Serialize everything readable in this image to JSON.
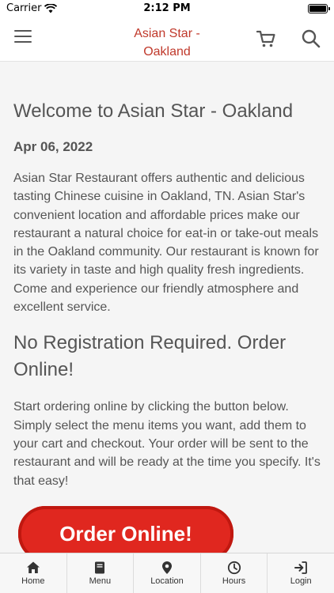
{
  "status_bar": {
    "carrier": "Carrier",
    "time": "2:12 PM"
  },
  "header": {
    "title": "Asian Star - Oakland"
  },
  "main": {
    "heading": "Welcome to Asian Star - Oakland",
    "date": "Apr 06, 2022",
    "intro": "Asian Star Restaurant offers authentic and delicious tasting Chinese cuisine in Oakland, TN. Asian Star's convenient location and affordable prices make our restaurant a natural choice for eat-in or take-out meals in the Oakland community. Our restaurant is known for its variety in taste and high quality fresh ingredients. Come and experience our friendly atmosphere and excellent service.",
    "subheading": "No Registration Required. Order Online!",
    "instructions": "Start ordering online by clicking the button below. Simply select the menu items you want, add them to your cart and checkout. Your order will be sent to the restaurant and will be ready at the time you specify. It's that easy!",
    "order_button": "Order Online!"
  },
  "tabs": [
    {
      "label": "Home",
      "icon": "home-icon"
    },
    {
      "label": "Menu",
      "icon": "book-icon"
    },
    {
      "label": "Location",
      "icon": "map-pin-icon"
    },
    {
      "label": "Hours",
      "icon": "clock-icon"
    },
    {
      "label": "Login",
      "icon": "sign-in-icon"
    }
  ],
  "colors": {
    "accent": "#c0392b",
    "button": "#e0271f",
    "text": "#555555"
  }
}
